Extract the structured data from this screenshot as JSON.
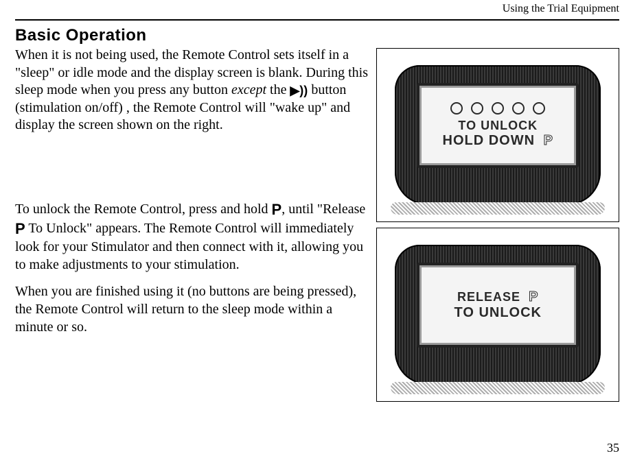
{
  "running_head": "Using the Trial Equipment",
  "page_number": "35",
  "section": {
    "title": "Basic Operation"
  },
  "paragraphs": {
    "p1a": "When it is not being used, the Remote Control sets itself in a \"sleep\" or idle mode and the display screen is blank. During this sleep mode when you press any button ",
    "p1b_italic": "except",
    "p1c": " the ",
    "p1_stim_icon": "▶))",
    "p1d": " button (stimulation on/off) , the Remote Control will \"wake up\" and display the screen shown on the right.",
    "p2a": "To unlock the Remote Control, press and hold ",
    "p2_p1": "P",
    "p2b": ", until \"Release ",
    "p2_p2": "P",
    "p2c": " To Unlock\" appears. The Remote Control will immediately look for your Stimulator and then connect with it, allowing you to make adjustments to your stimulation.",
    "p3": "When you are finished using it (no buttons are being pressed), the Remote Control will return to the sleep mode within a minute or so."
  },
  "figures": {
    "fig1": {
      "line1": "To Unlock",
      "line2a": "Hold Down ",
      "line2_icon": "P"
    },
    "fig2": {
      "line1a": "Release ",
      "line1_icon": "P",
      "line2": "To Unlock"
    }
  }
}
